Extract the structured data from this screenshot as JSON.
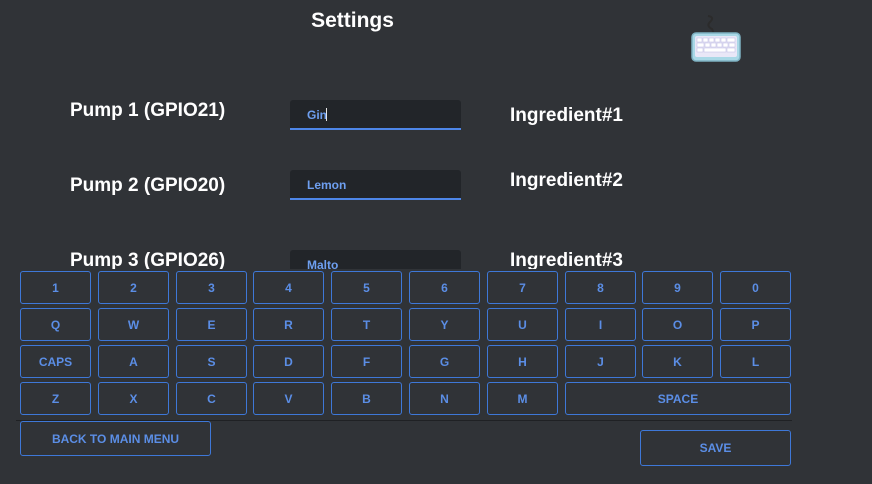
{
  "header": {
    "title": "Settings",
    "keyboard_icon": "keyboard-icon"
  },
  "pumps": [
    {
      "label": "Pump 1 (GPIO21)",
      "value": "Gin",
      "ingredient": "Ingredient#1"
    },
    {
      "label": "Pump 2 (GPIO20)",
      "value": "Lemon",
      "ingredient": "Ingredient#2"
    },
    {
      "label": "Pump 3 (GPIO26)",
      "value": "Malto",
      "ingredient": "Ingredient#3"
    }
  ],
  "keyboard": {
    "rows": [
      [
        "1",
        "2",
        "3",
        "4",
        "5",
        "6",
        "7",
        "8",
        "9",
        "0"
      ],
      [
        "Q",
        "W",
        "E",
        "R",
        "T",
        "Y",
        "U",
        "I",
        "O",
        "P"
      ],
      [
        "CAPS",
        "A",
        "S",
        "D",
        "F",
        "G",
        "H",
        "J",
        "K",
        "L"
      ],
      [
        "Z",
        "X",
        "C",
        "V",
        "B",
        "N",
        "M",
        "SPACE"
      ]
    ]
  },
  "footer": {
    "back_label": "BACK TO MAIN MENU",
    "save_label": "SAVE"
  },
  "colors": {
    "background": "#303337",
    "accent": "#3e78d8",
    "field_bg": "#222529",
    "text": "#ffffff"
  }
}
